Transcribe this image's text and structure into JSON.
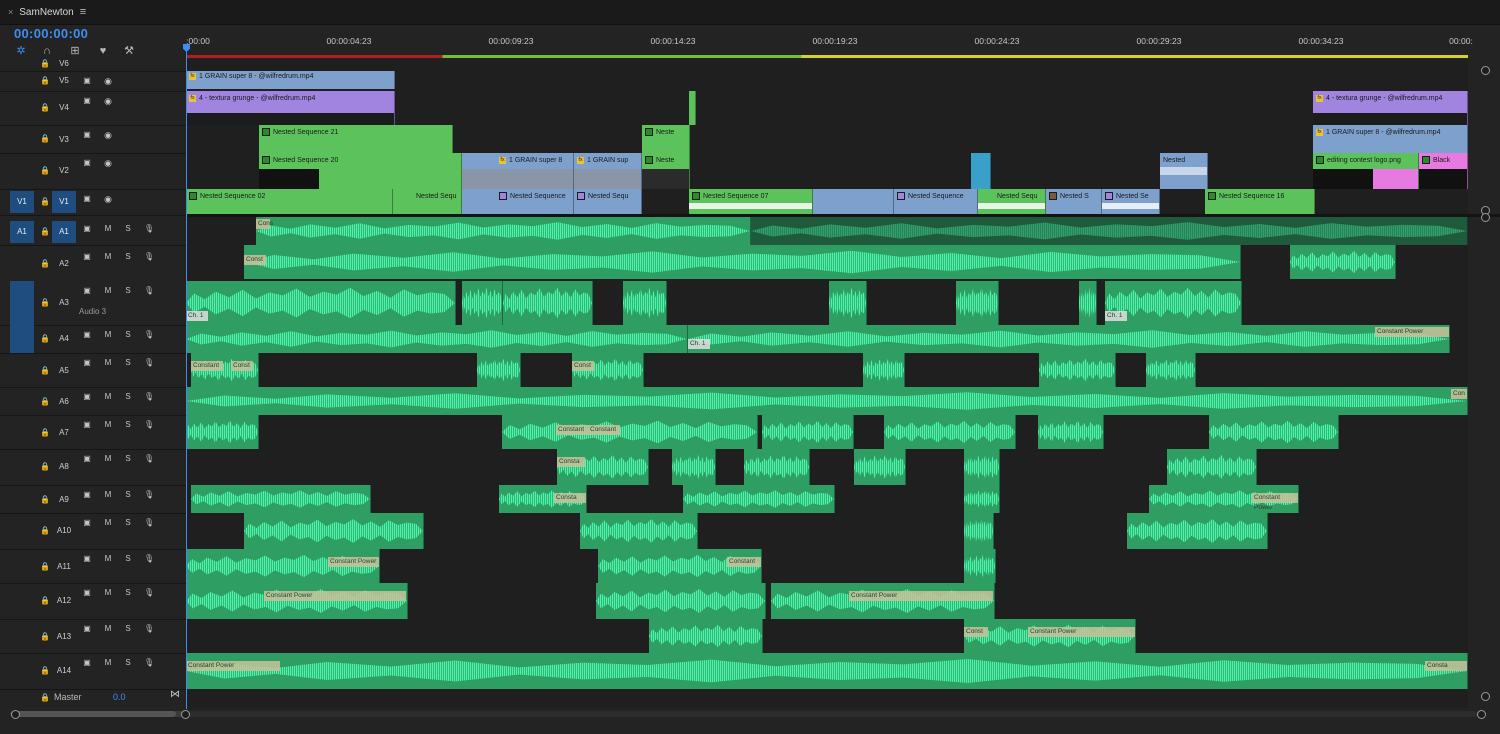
{
  "sequence": {
    "tab_name": "SamNewton",
    "close_glyph": "×",
    "menu_glyph": "≡"
  },
  "timecode": "00:00:00:00",
  "ruler": {
    "labels": [
      ":00:00",
      "00:00:04:23",
      "00:00:09:23",
      "00:00:14:23",
      "00:00:19:23",
      "00:00:24:23",
      "00:00:29:23",
      "00:00:34:23",
      "00:00:"
    ]
  },
  "video_tracks": [
    {
      "name": "V6",
      "source": ""
    },
    {
      "name": "V5",
      "source": ""
    },
    {
      "name": "V4",
      "source": ""
    },
    {
      "name": "V3",
      "source": ""
    },
    {
      "name": "V2",
      "source": ""
    },
    {
      "name": "V1",
      "source": "V1"
    }
  ],
  "audio_tracks": [
    {
      "name": "A1",
      "source": "A1"
    },
    {
      "name": "A2",
      "source": ""
    },
    {
      "name": "A3",
      "source": "",
      "label": "Audio 3"
    },
    {
      "name": "A4",
      "source": ""
    },
    {
      "name": "A5",
      "source": ""
    },
    {
      "name": "A6",
      "source": ""
    },
    {
      "name": "A7",
      "source": ""
    },
    {
      "name": "A8",
      "source": ""
    },
    {
      "name": "A9",
      "source": ""
    },
    {
      "name": "A10",
      "source": ""
    },
    {
      "name": "A11",
      "source": ""
    },
    {
      "name": "A12",
      "source": ""
    },
    {
      "name": "A13",
      "source": ""
    },
    {
      "name": "A14",
      "source": ""
    }
  ],
  "master": {
    "label": "Master",
    "value": "0.0"
  },
  "track_buttons": {
    "mute": "M",
    "solo": "S"
  },
  "colors": {
    "accent": "#3e8ef0",
    "clip_blue": "#7ea0cd",
    "clip_purple": "#a084e0",
    "clip_green": "#5cc35c",
    "clip_pink": "#e879e0",
    "audio_green": "#2f9e63"
  },
  "clips": {
    "v5_a": "1 GRAIN super 8 - @wilfredrum.mp4",
    "v4_a": "4 - textura grunge - @wilfredrum.mp4",
    "v4_b": "4 - textura grunge - @wilfredrum.mp4",
    "v3_a": "Nested Sequence 21",
    "v3_b": "Neste",
    "v3_c": "1 GRAIN super 8 - @wilfredrum.mp4",
    "v2_a": "Nested Sequence 20",
    "v2_b": "1 GRAIN super 8",
    "v2_c": "1 GRAIN sup",
    "v2_d": "Neste",
    "v2_e": "Nested",
    "v2_f": "editing contest logo.png",
    "v2_g": "Black",
    "v1_a": "Nested Sequence 02",
    "v1_b": "Nested Sequ",
    "v1_c": "Nested Sequence",
    "v1_d": "Nested Sequ",
    "v1_e": "Nested Sequence 07",
    "v1_f": "Nested Sequence",
    "v1_g": "Nested Sequ",
    "v1_h": "Nested S",
    "v1_i": "Nested Se",
    "v1_j": "Nested Sequence 16",
    "cp_full": "Constant Power",
    "cp_short1": "Constant",
    "cp_short2": "Const",
    "cp_short3": "Cons",
    "cp_short4": "Con",
    "cp_short5": "Consta",
    "ch1": "Ch. 1"
  },
  "icons": [
    "snap-icon",
    "linked-selection-icon",
    "add-marker-icon",
    "marker-icon",
    "wrench-icon",
    "lock-icon",
    "film-icon",
    "eye-icon",
    "mic-icon",
    "pin-icon"
  ]
}
